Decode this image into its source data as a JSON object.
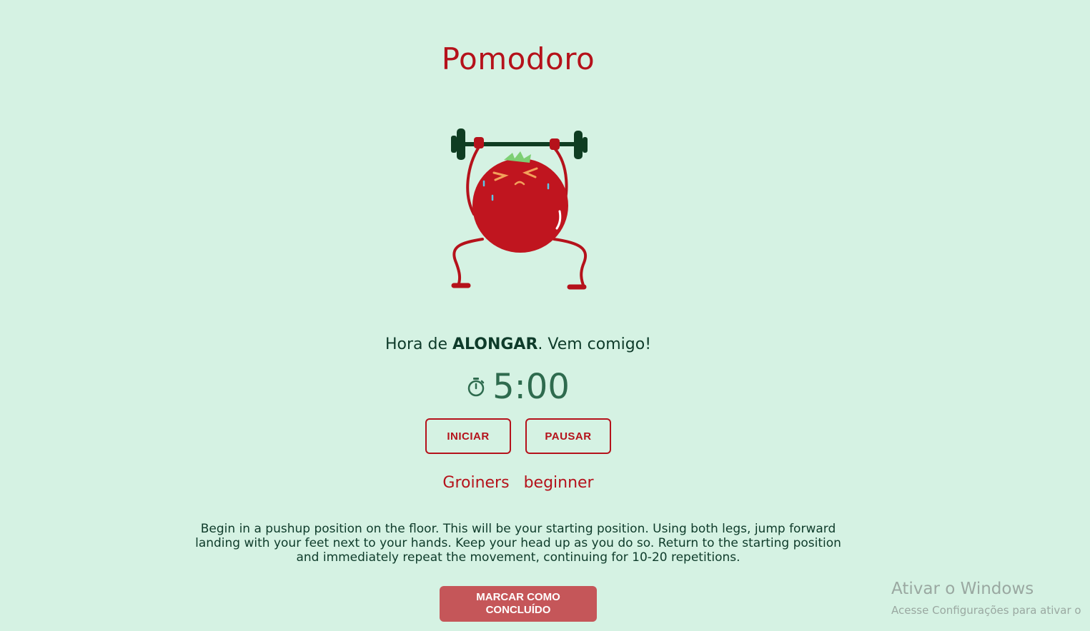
{
  "app": {
    "title": "Pomodoro"
  },
  "headline": {
    "prefix": "Hora de ",
    "emphasis": "ALONGAR",
    "suffix": ". Vem comigo!"
  },
  "timer": {
    "icon": "stopwatch-icon",
    "value": "5:00"
  },
  "controls": {
    "start_label": "INICIAR",
    "pause_label": "PAUSAR"
  },
  "exercise": {
    "name": "Groiners",
    "level": "beginner",
    "description": "Begin in a pushup position on the floor. This will be your starting position. Using both legs, jump forward landing with your feet next to your hands. Keep your head up as you do so. Return to the starting position and immediately repeat the movement, continuing for 10-20 repetitions."
  },
  "done_button": {
    "label": "MARCAR COMO CONCLUÍDO"
  },
  "watermark": {
    "title": "Ativar o Windows",
    "subtitle": "Acesse Configurações para ativar o"
  },
  "colors": {
    "background": "#d5f2e3",
    "accent": "#b5121b",
    "text_dark": "#0e3b2a",
    "timer": "#2e6b4e",
    "done_button": "#c55659"
  }
}
